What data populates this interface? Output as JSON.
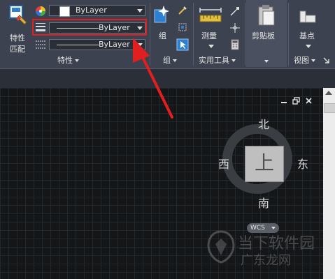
{
  "ribbon": {
    "match_props_label_1": "特性",
    "match_props_label_2": "匹配",
    "color_combo": "ByLayer",
    "linetype_combo": "ByLayer",
    "lineweight_combo": "ByLayer",
    "panel_properties": "特性",
    "group_label": "组",
    "panel_group": "组",
    "measure_label": "测量",
    "panel_utilities": "实用工具",
    "clipboard_label": "剪贴板",
    "base_label": "基点",
    "panel_view": "视图"
  },
  "viewcube": {
    "north": "北",
    "south": "南",
    "west": "西",
    "east": "东",
    "face": "上",
    "wcs": "WCS"
  },
  "watermark": {
    "line1": "当下软件园",
    "line2": "广东龙网"
  },
  "colors": {
    "ribbon_bg": "#3c4250",
    "highlight": "#e02020",
    "canvas_bg": "#141618"
  }
}
